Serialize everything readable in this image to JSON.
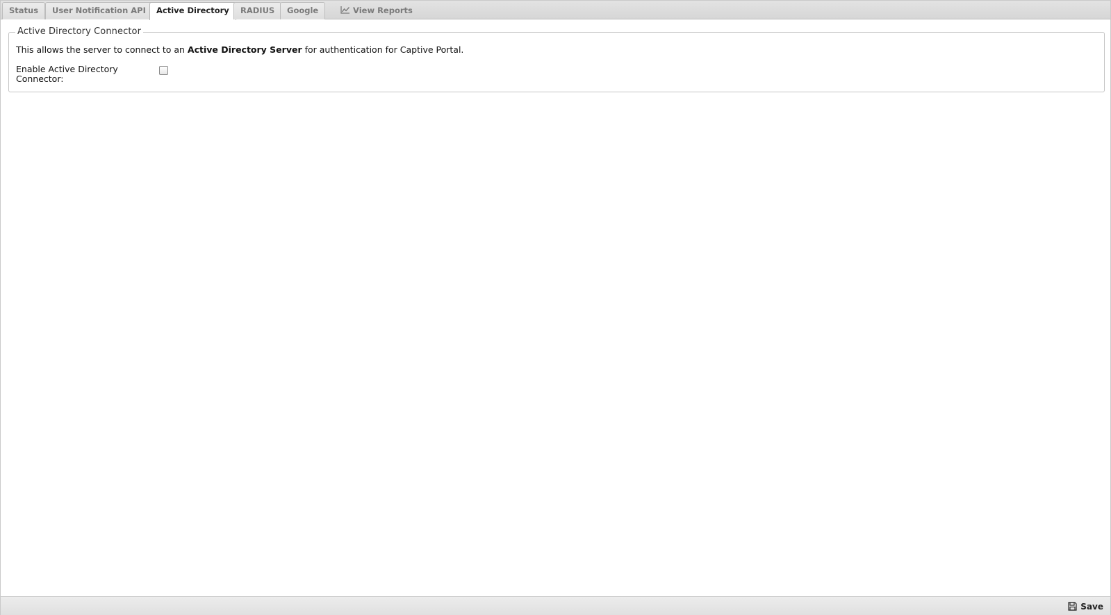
{
  "tabs": [
    {
      "label": "Status",
      "active": false
    },
    {
      "label": "User Notification API",
      "active": false
    },
    {
      "label": "Active Directory",
      "active": true
    },
    {
      "label": "RADIUS",
      "active": false
    },
    {
      "label": "Google",
      "active": false
    },
    {
      "label": "View Reports",
      "active": false,
      "icon": "line-chart-icon"
    }
  ],
  "connector": {
    "legend": "Active Directory Connector",
    "desc_prefix": "This allows the server to connect to an ",
    "desc_bold": "Active Directory Server",
    "desc_suffix": " for authentication for Captive Portal.",
    "enable_label": "Enable Active Directory Connector:",
    "enabled": false
  },
  "toolbar": {
    "save_label": "Save",
    "save_icon": "floppy-disk-icon"
  }
}
